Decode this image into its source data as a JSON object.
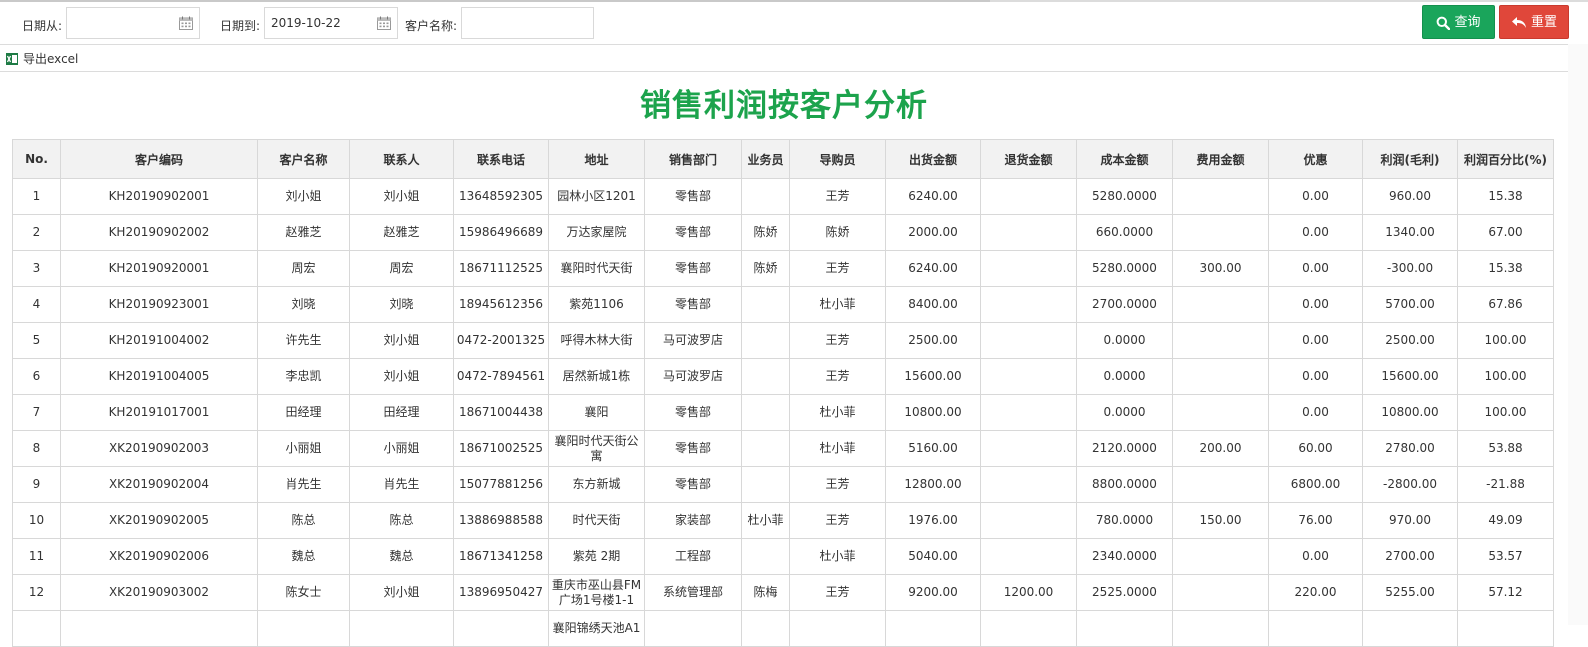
{
  "filters": {
    "date_from_label": "日期从:",
    "date_from_value": "",
    "date_to_label": "日期到:",
    "date_to_value": "2019-10-22",
    "customer_label": "客户名称:",
    "customer_value": "",
    "search_label": "查询",
    "reset_label": "重置"
  },
  "toolbar": {
    "export_label": "导出excel"
  },
  "report": {
    "title": "销售利润按客户分析"
  },
  "table": {
    "columns": [
      "No.",
      "客户编码",
      "客户名称",
      "联系人",
      "联系电话",
      "地址",
      "销售部门",
      "业务员",
      "导购员",
      "出货金额",
      "退货金额",
      "成本金额",
      "费用金额",
      "优惠",
      "利润(毛利)",
      "利润百分比(%)"
    ],
    "rows": [
      [
        "1",
        "KH20190902001",
        "刘小姐",
        "刘小姐",
        "13648592305",
        "园林小区1201",
        "零售部",
        "",
        "王芳",
        "6240.00",
        "",
        "5280.0000",
        "",
        "0.00",
        "960.00",
        "15.38"
      ],
      [
        "2",
        "KH20190902002",
        "赵雅芝",
        "赵雅芝",
        "15986496689",
        "万达家屋院",
        "零售部",
        "陈娇",
        "陈娇",
        "2000.00",
        "",
        "660.0000",
        "",
        "0.00",
        "1340.00",
        "67.00"
      ],
      [
        "3",
        "KH20190920001",
        "周宏",
        "周宏",
        "18671112525",
        "襄阳时代天街",
        "零售部",
        "陈娇",
        "王芳",
        "6240.00",
        "",
        "5280.0000",
        "300.00",
        "0.00",
        "-300.00",
        "15.38"
      ],
      [
        "4",
        "KH20190923001",
        "刘晓",
        "刘晓",
        "18945612356",
        "紫苑1106",
        "零售部",
        "",
        "杜小菲",
        "8400.00",
        "",
        "2700.0000",
        "",
        "0.00",
        "5700.00",
        "67.86"
      ],
      [
        "5",
        "KH20191004002",
        "许先生",
        "刘小姐",
        "0472-2001325",
        "呼得木林大街",
        "马可波罗店",
        "",
        "王芳",
        "2500.00",
        "",
        "0.0000",
        "",
        "0.00",
        "2500.00",
        "100.00"
      ],
      [
        "6",
        "KH20191004005",
        "李忠凯",
        "刘小姐",
        "0472-7894561",
        "居然新城1栋",
        "马可波罗店",
        "",
        "王芳",
        "15600.00",
        "",
        "0.0000",
        "",
        "0.00",
        "15600.00",
        "100.00"
      ],
      [
        "7",
        "KH20191017001",
        "田经理",
        "田经理",
        "18671004438",
        "襄阳",
        "零售部",
        "",
        "杜小菲",
        "10800.00",
        "",
        "0.0000",
        "",
        "0.00",
        "10800.00",
        "100.00"
      ],
      [
        "8",
        "XK20190902003",
        "小丽姐",
        "小丽姐",
        "18671002525",
        "襄阳时代天街公寓",
        "零售部",
        "",
        "杜小菲",
        "5160.00",
        "",
        "2120.0000",
        "200.00",
        "60.00",
        "2780.00",
        "53.88"
      ],
      [
        "9",
        "XK20190902004",
        "肖先生",
        "肖先生",
        "15077881256",
        "东方新城",
        "零售部",
        "",
        "王芳",
        "12800.00",
        "",
        "8800.0000",
        "",
        "6800.00",
        "-2800.00",
        "-21.88"
      ],
      [
        "10",
        "XK20190902005",
        "陈总",
        "陈总",
        "13886988588",
        "时代天街",
        "家装部",
        "杜小菲",
        "王芳",
        "1976.00",
        "",
        "780.0000",
        "150.00",
        "76.00",
        "970.00",
        "49.09"
      ],
      [
        "11",
        "XK20190902006",
        "魏总",
        "魏总",
        "18671341258",
        "紫苑 2期",
        "工程部",
        "",
        "杜小菲",
        "5040.00",
        "",
        "2340.0000",
        "",
        "0.00",
        "2700.00",
        "53.57"
      ],
      [
        "12",
        "XK20190903002",
        "陈女士",
        "刘小姐",
        "13896950427",
        "重庆市巫山县FM广场1号楼1-1",
        "系统管理部",
        "陈梅",
        "王芳",
        "9200.00",
        "1200.00",
        "2525.0000",
        "",
        "220.00",
        "5255.00",
        "57.12"
      ],
      [
        "",
        "",
        "",
        "",
        "",
        "襄阳锦绣天池A1",
        "",
        "",
        "",
        "",
        "",
        "",
        "",
        "",
        "",
        ""
      ]
    ]
  },
  "colors": {
    "title": "#1ca34c",
    "search_button": "#1aa55b",
    "reset_button": "#e0473a"
  },
  "icons": {
    "date_from": "calendar-icon",
    "date_to": "calendar-icon",
    "search": "search-icon",
    "reset": "undo-icon",
    "export": "excel-icon"
  }
}
